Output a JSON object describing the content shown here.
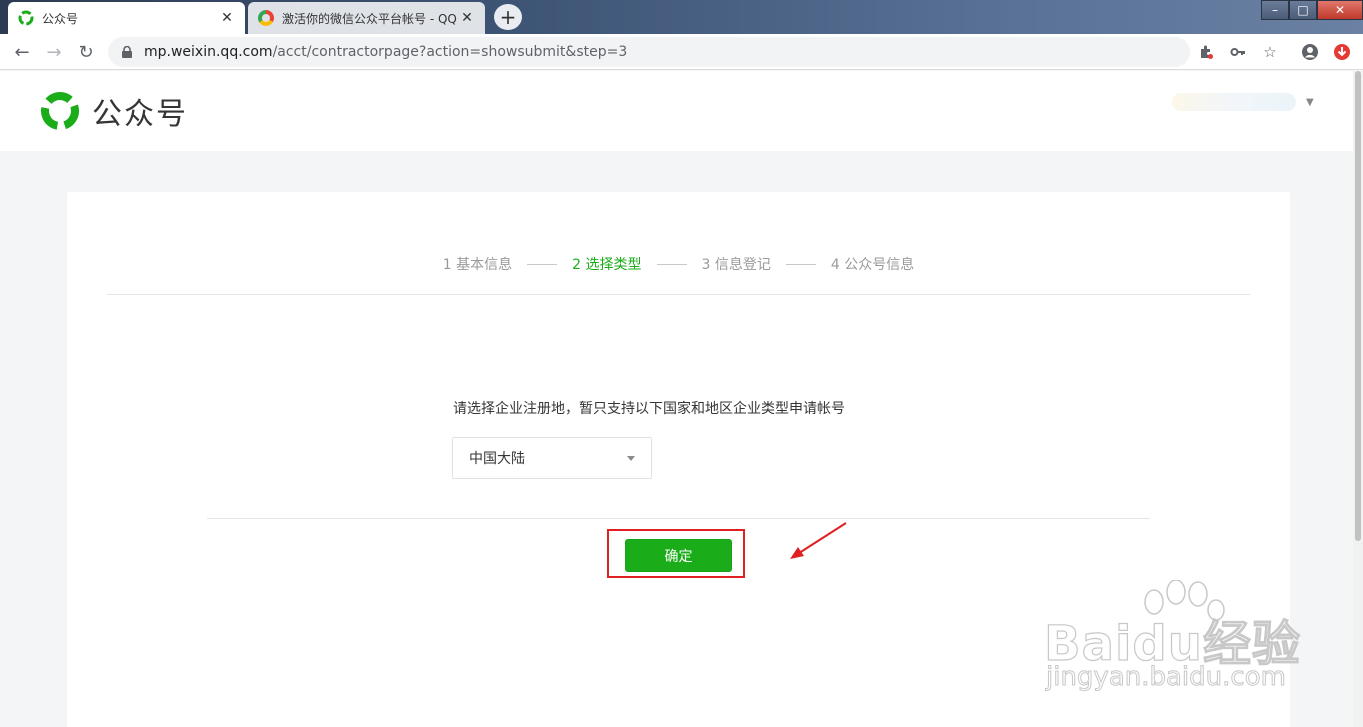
{
  "browser": {
    "tabs": [
      {
        "title": "公众号",
        "active": true
      },
      {
        "title": "激活你的微信公众平台帐号 - QQ",
        "active": false
      }
    ],
    "url_host": "mp.weixin.qq.com",
    "url_path": "/acct/contractorpage?action=showsubmit&step=3"
  },
  "header": {
    "brand_name": "公众号"
  },
  "steps": [
    {
      "label": "1 基本信息"
    },
    {
      "label": "2 选择类型"
    },
    {
      "label": "3 信息登记"
    },
    {
      "label": "4 公众号信息"
    }
  ],
  "current_step": 2,
  "form": {
    "instruction": "请选择企业注册地，暂只支持以下国家和地区企业类型申请帐号",
    "region_value": "中国大陆",
    "confirm_label": "确定"
  },
  "watermark": {
    "text": "Baidu经验",
    "url": "jingyan.baidu.com"
  },
  "colors": {
    "brand_green": "#1aad19",
    "annotation_red": "#e02020"
  }
}
